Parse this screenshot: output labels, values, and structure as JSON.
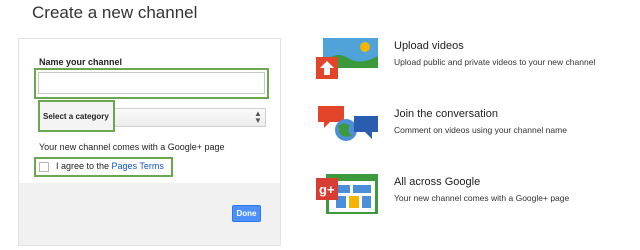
{
  "header": {
    "title": "Create a new channel"
  },
  "form": {
    "name_label": "Name your channel",
    "name_value": "",
    "category_label": "Select a category",
    "gplus_note": "Your new channel comes with a Google+ page",
    "agree_text": "I agree to the ",
    "agree_link": "Pages Terms",
    "done_label": "Done"
  },
  "features": [
    {
      "icon": "upload-videos-icon",
      "title": "Upload videos",
      "description": "Upload public and private videos to your new channel"
    },
    {
      "icon": "conversation-icon",
      "title": "Join the conversation",
      "description": "Comment on videos using your channel name"
    },
    {
      "icon": "google-plus-icon",
      "title": "All across Google",
      "description": "Your new channel comes with a Google+ page"
    }
  ],
  "colors": {
    "highlight_green": "#6aa84f",
    "done_button_blue": "#4d90fe",
    "link_blue": "#1155cc"
  }
}
